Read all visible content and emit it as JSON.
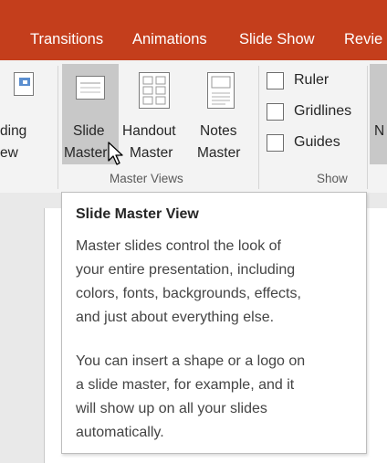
{
  "tabs": [
    "Transitions",
    "Animations",
    "Slide Show",
    "Revie"
  ],
  "ribbon": {
    "reading_view_partial": [
      "ding",
      "ew"
    ],
    "slide_master": [
      "Slide",
      "Master"
    ],
    "handout_master": [
      "Handout",
      "Master"
    ],
    "notes_master": [
      "Notes",
      "Master"
    ],
    "master_views_group": "Master Views",
    "show_group": "Show",
    "show_items": [
      "Ruler",
      "Gridlines",
      "Guides"
    ],
    "next_partial": "N"
  },
  "tooltip": {
    "title": "Slide Master View",
    "paragraph1": [
      "Master slides control the look of",
      "your entire presentation, including",
      "colors, fonts, backgrounds, effects,",
      "and just about everything else."
    ],
    "paragraph2": [
      "You can insert a shape or a logo on",
      "a slide master, for example, and it",
      "will show up on all your slides",
      "automatically."
    ]
  },
  "colors": {
    "tab_bar": "#c43e1c",
    "ribbon": "#f3f3f3",
    "hover_button": "#c8c8c8"
  }
}
